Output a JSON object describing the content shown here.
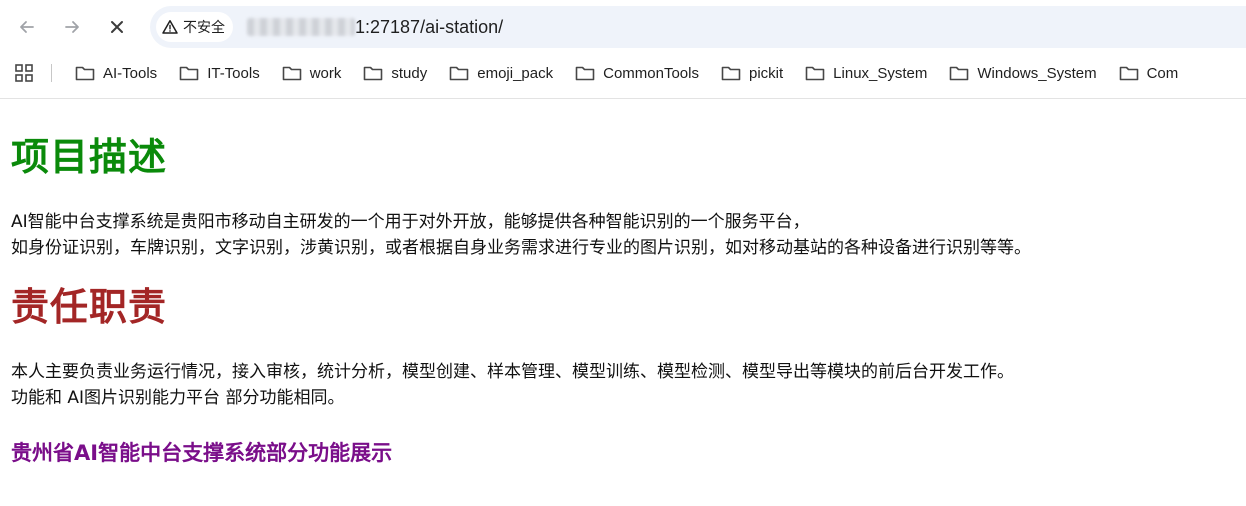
{
  "browser": {
    "security_chip": "不安全",
    "url_visible": "1:27187/ai-station/",
    "bookmarks": [
      "AI-Tools",
      "IT-Tools",
      "work",
      "study",
      "emoji_pack",
      "CommonTools",
      "pickit",
      "Linux_System",
      "Windows_System",
      "Com"
    ]
  },
  "page": {
    "heading_description": "项目描述",
    "description_line1": "AI智能中台支撑系统是贵阳市移动自主研发的一个用于对外开放，能够提供各种智能识别的一个服务平台，",
    "description_line2": "如身份证识别，车牌识别，文字识别，涉黄识别，或者根据自身业务需求进行专业的图片识别，如对移动基站的各种设备进行识别等等。",
    "heading_responsibility": "责任职责",
    "responsibility_line1": "本人主要负责业务运行情况，接入审核，统计分析，模型创建、样本管理、模型训练、模型检测、模型导出等模块的前后台开发工作。",
    "responsibility_line2": "功能和 AI图片识别能力平台 部分功能相同。",
    "subheading": "贵州省AI智能中台支撑系统部分功能展示"
  },
  "colors": {
    "heading_green": "#0a8a0a",
    "heading_red": "#a32626",
    "subheading_purple": "#7a0e8a"
  }
}
